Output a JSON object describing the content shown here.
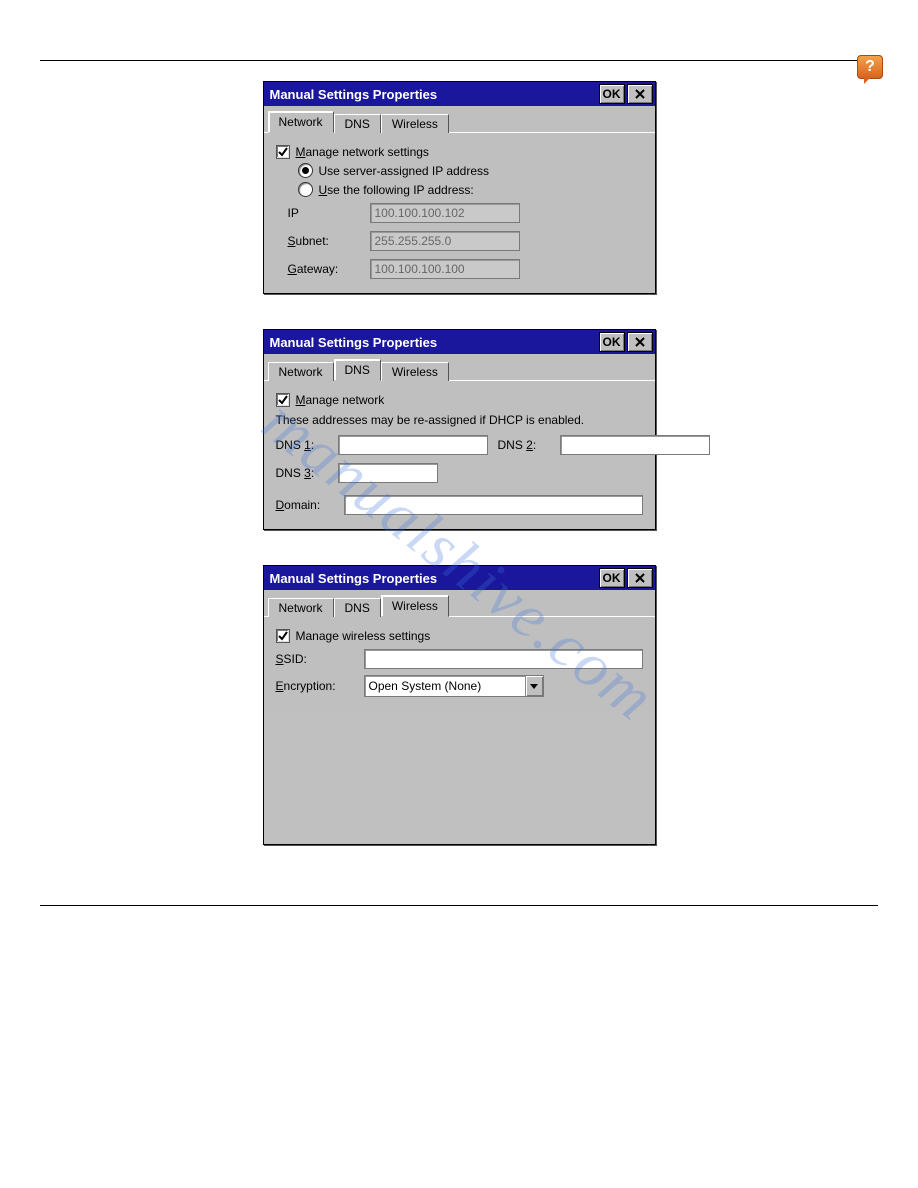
{
  "watermark_text": "manualshive.com",
  "help_badge": "?",
  "ok_label": "OK",
  "close_label": "×",
  "tabs": {
    "network": "Network",
    "dns": "DNS",
    "wireless": "Wireless"
  },
  "dialog1": {
    "title": "Manual Settings Properties",
    "active_tab": "Network",
    "manage_label": "Manage network settings",
    "manage_checked": true,
    "radio_server_label": "Use server-assigned IP address",
    "radio_server_selected": true,
    "radio_static_label": "Use the following IP address:",
    "radio_static_selected": false,
    "ip_label": "IP",
    "ip_value": "100.100.100.102",
    "subnet_label": "Subnet:",
    "subnet_value": "255.255.255.0",
    "gateway_label": "Gateway:",
    "gateway_value": "100.100.100.100"
  },
  "dialog2": {
    "title": "Manual Settings Properties",
    "active_tab": "DNS",
    "manage_label": "Manage network",
    "manage_checked": true,
    "note": "These addresses may be re-assigned if DHCP is enabled.",
    "dns1_label": "DNS 1:",
    "dns1_value": "",
    "dns2_label": "DNS 2:",
    "dns2_value": "",
    "dns3_label": "DNS 3:",
    "dns3_value": "",
    "domain_label": "Domain:",
    "domain_value": ""
  },
  "dialog3": {
    "title": "Manual Settings Properties",
    "active_tab": "Wireless",
    "manage_label": "Manage wireless settings",
    "manage_checked": true,
    "ssid_label": "SSID:",
    "ssid_value": "",
    "encryption_label": "Encryption:",
    "encryption_value": "Open System (None)"
  }
}
